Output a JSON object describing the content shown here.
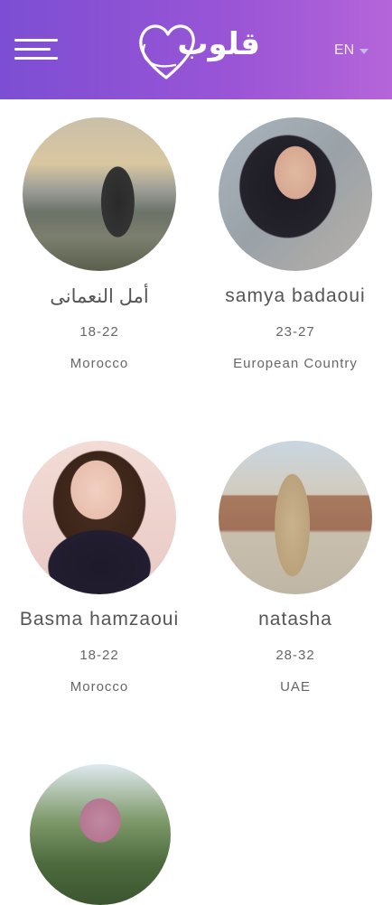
{
  "header": {
    "menu_icon": "hamburger-menu-icon",
    "logo_text": "قلوب",
    "language": {
      "selected": "EN",
      "icon": "chevron-down-icon"
    },
    "colors": {
      "gradient_start": "#7c4ed3",
      "gradient_end": "#b565d9"
    }
  },
  "profiles": [
    {
      "name": "أمل النعمانى",
      "age_range": "18-22",
      "country": "Morocco"
    },
    {
      "name": "samya badaoui",
      "age_range": "23-27",
      "country": "European Country"
    },
    {
      "name": "Basma hamzaoui",
      "age_range": "18-22",
      "country": "Morocco"
    },
    {
      "name": "natasha",
      "age_range": "28-32",
      "country": "UAE"
    }
  ]
}
